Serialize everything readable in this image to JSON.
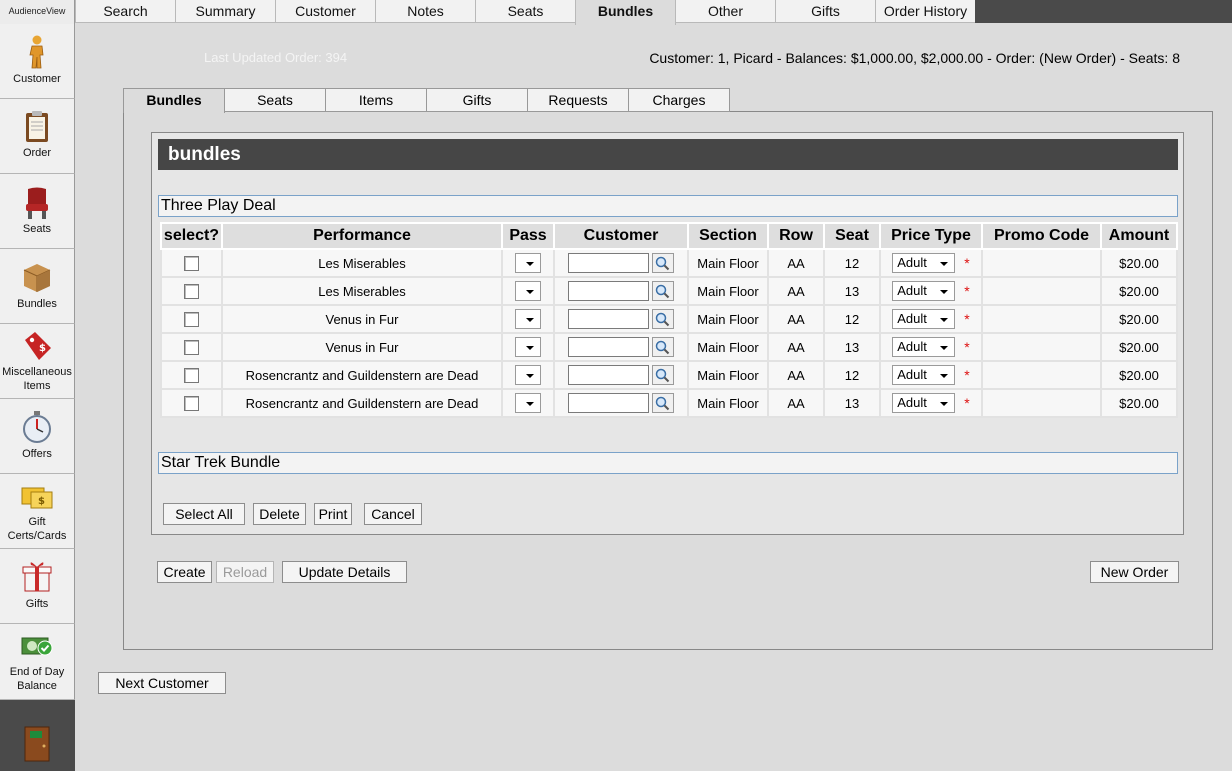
{
  "brand": "AudienceView",
  "sidebar": [
    {
      "label": "Customer",
      "icon": "customer-icon"
    },
    {
      "label": "Order",
      "icon": "clipboard-icon"
    },
    {
      "label": "Seats",
      "icon": "seat-icon"
    },
    {
      "label": "Bundles",
      "icon": "box-icon"
    },
    {
      "label": "Miscellaneous Items",
      "icon": "price-tag-icon"
    },
    {
      "label": "Offers",
      "icon": "stopwatch-icon"
    },
    {
      "label": "Gift Certs/Cards",
      "icon": "gift-card-icon"
    },
    {
      "label": "Gifts",
      "icon": "gift-icon"
    },
    {
      "label": "End of Day Balance",
      "icon": "cash-check-icon"
    }
  ],
  "top_tabs": [
    "Search",
    "Summary",
    "Customer",
    "Notes",
    "Seats",
    "Bundles",
    "Other",
    "Gifts",
    "Order History"
  ],
  "active_top_tab": "Bundles",
  "last_updated": "Last Updated Order: 394",
  "customer_info": "Customer: 1, Picard - Balances: $1,000.00, $2,000.00 - Order: (New Order) - Seats: 8",
  "sub_tabs": [
    "Bundles",
    "Seats",
    "Items",
    "Gifts",
    "Requests",
    "Charges"
  ],
  "active_sub_tab": "Bundles",
  "section_header": "bundles",
  "bundles": [
    {
      "title": "Three Play Deal",
      "columns": [
        "select?",
        "Performance",
        "Pass",
        "Customer",
        "Section",
        "Row",
        "Seat",
        "Price Type",
        "Promo Code",
        "Amount"
      ],
      "rows": [
        {
          "performance": "Les Miserables",
          "section": "Main Floor",
          "row": "AA",
          "seat": "12",
          "price_type": "Adult",
          "amount": "$20.00"
        },
        {
          "performance": "Les Miserables",
          "section": "Main Floor",
          "row": "AA",
          "seat": "13",
          "price_type": "Adult",
          "amount": "$20.00"
        },
        {
          "performance": "Venus in Fur",
          "section": "Main Floor",
          "row": "AA",
          "seat": "12",
          "price_type": "Adult",
          "amount": "$20.00"
        },
        {
          "performance": "Venus in Fur",
          "section": "Main Floor",
          "row": "AA",
          "seat": "13",
          "price_type": "Adult",
          "amount": "$20.00"
        },
        {
          "performance": "Rosencrantz and Guildenstern are Dead",
          "section": "Main Floor",
          "row": "AA",
          "seat": "12",
          "price_type": "Adult",
          "amount": "$20.00"
        },
        {
          "performance": "Rosencrantz and Guildenstern are Dead",
          "section": "Main Floor",
          "row": "AA",
          "seat": "13",
          "price_type": "Adult",
          "amount": "$20.00"
        }
      ]
    },
    {
      "title": "Star Trek Bundle"
    }
  ],
  "required_mark": "*",
  "panel_buttons": {
    "select_all": "Select All",
    "delete": "Delete",
    "print": "Print",
    "cancel": "Cancel"
  },
  "footer_buttons": {
    "create": "Create",
    "reload": "Reload",
    "update_details": "Update Details",
    "new_order": "New Order"
  },
  "next_customer": "Next Customer"
}
